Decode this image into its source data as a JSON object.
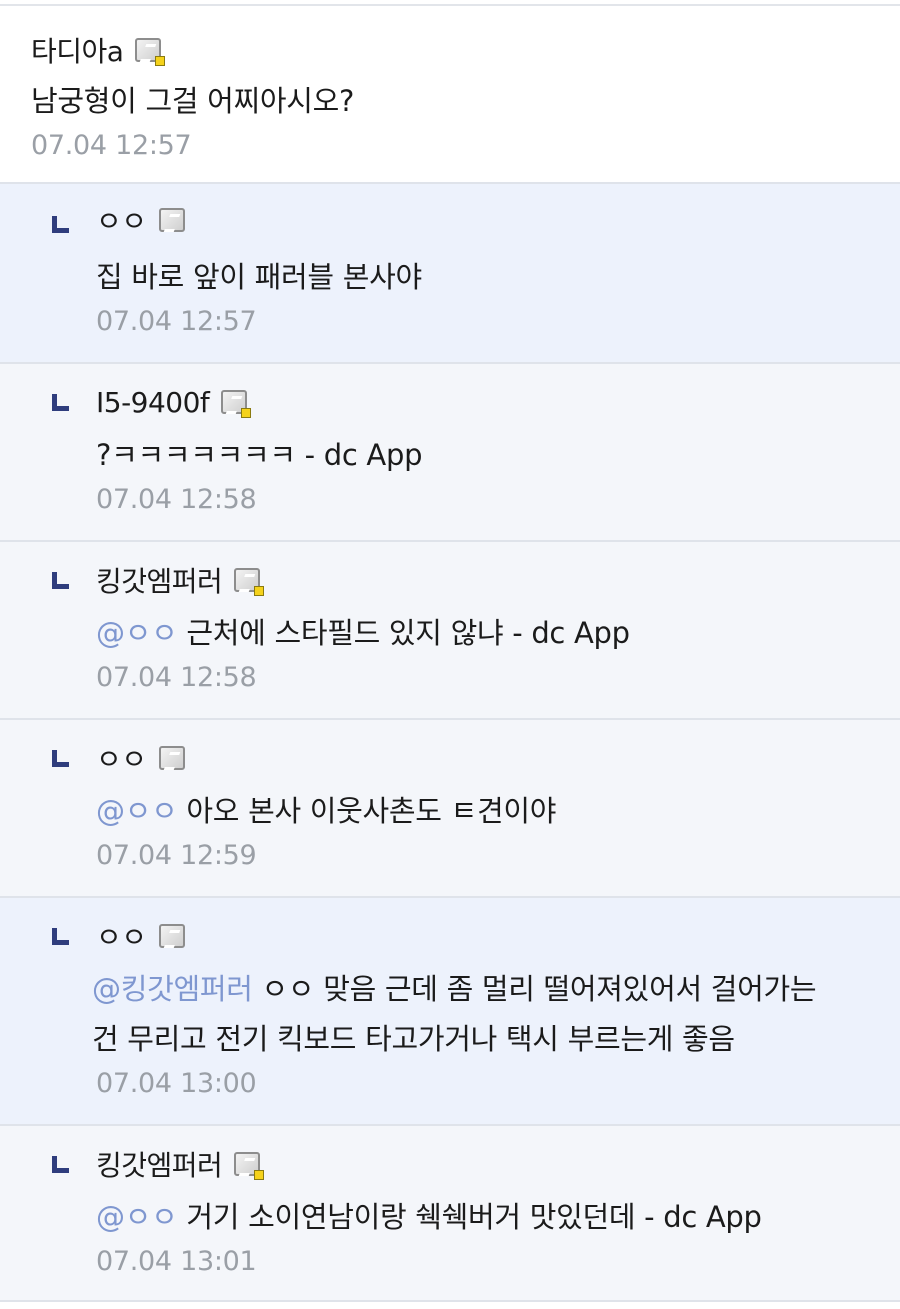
{
  "comments": [
    {
      "nick": "타디아a",
      "text": "남궁형이 그걸 어찌아시오?",
      "date": "07.04 12:57"
    }
  ],
  "replies": [
    {
      "nick": "ㅇㅇ",
      "mention": "",
      "text": "집 바로 앞이 패러블 본사야",
      "date": "07.04 12:57"
    },
    {
      "nick": "I5-9400f",
      "mention": "",
      "text": "?ㅋㅋㅋㅋㅋㅋㅋ - dc App",
      "date": "07.04 12:58"
    },
    {
      "nick": "킹갓엠퍼러",
      "mention": "@ㅇㅇ",
      "text": "근처에 스타필드 있지 않냐 - dc App",
      "date": "07.04 12:58"
    },
    {
      "nick": "ㅇㅇ",
      "mention": "@ㅇㅇ",
      "text": "아오 본사 이웃사촌도 ㅌ견이야",
      "date": "07.04 12:59"
    },
    {
      "nick": "ㅇㅇ",
      "mention": "@킹갓엠퍼러",
      "text": "ㅇㅇ 맞음 근데 좀 멀리 떨어져있어서 걸어가는",
      "text2": "건 무리고 전기 킥보드 타고가거나 택시 부르는게 좋음",
      "date": "07.04 13:00"
    },
    {
      "nick": "킹갓엠퍼러",
      "mention": "@ㅇㅇ",
      "text": "거기 소이연남이랑 쉑쉑버거 맛있던데 - dc App",
      "date": "07.04 13:01"
    }
  ],
  "icons": {
    "gallery_icon": "gallery-badge-icon",
    "reply_icon": "reply-branch-icon"
  },
  "colors": {
    "mention": "#7f97d0",
    "date": "#9a9fa6",
    "branch": "#2f3d7d",
    "reply_bg": "#f4f6fa",
    "reply_highlight_bg": "#edf2fc"
  }
}
